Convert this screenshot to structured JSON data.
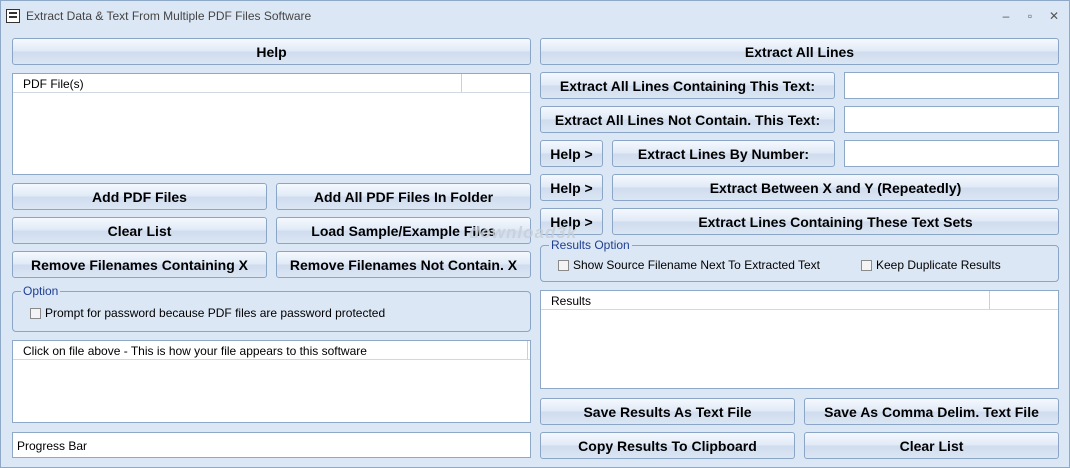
{
  "window": {
    "title": "Extract Data & Text From Multiple PDF Files Software",
    "controls": {
      "minimize": "–",
      "maximize": "▫",
      "close": "✕"
    }
  },
  "left": {
    "help_button": "Help",
    "pdf_list_header": "PDF File(s)",
    "add_pdf_files": "Add PDF Files",
    "add_all_in_folder": "Add All PDF Files In Folder",
    "clear_list": "Clear List",
    "load_sample": "Load Sample/Example Files",
    "remove_containing": "Remove Filenames Containing X",
    "remove_not_containing": "Remove Filenames Not Contain. X",
    "option_group_label": "Option",
    "password_prompt_label": "Prompt for password because PDF files are password protected",
    "preview_header": "Click on file above - This is how your file appears to this software",
    "progress_bar": "Progress Bar"
  },
  "right": {
    "extract_all_lines": "Extract All Lines",
    "extract_containing": "Extract All Lines Containing This Text:",
    "extract_containing_value": "",
    "extract_not_contain": "Extract All Lines Not Contain. This Text:",
    "extract_not_contain_value": "",
    "help_arrow": "Help >",
    "extract_by_number": "Extract Lines By Number:",
    "extract_by_number_value": "",
    "extract_between": "Extract Between X and Y (Repeatedly)",
    "extract_text_sets": "Extract Lines Containing These Text Sets",
    "results_option_label": "Results Option",
    "show_source_filename": "Show Source Filename Next To Extracted Text",
    "keep_duplicates": "Keep Duplicate Results",
    "results_header": "Results",
    "save_text_file": "Save Results As Text File",
    "save_comma_delim": "Save As Comma Delim. Text File",
    "copy_clipboard": "Copy Results To Clipboard",
    "clear_list": "Clear List"
  },
  "watermark": "download3k"
}
